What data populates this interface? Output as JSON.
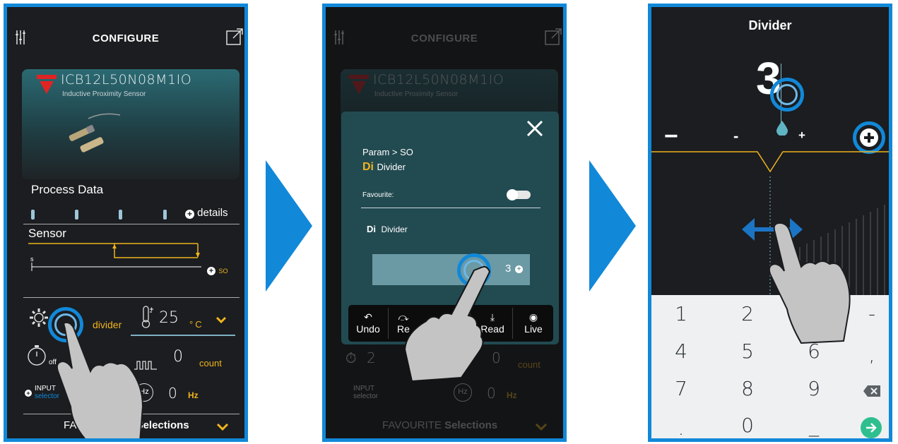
{
  "panel1": {
    "title": "CONFIGURE",
    "device_model": "ICB12L50N08M1IO",
    "device_type": "Inductive Proximity Sensor",
    "process_data_label": "Process Data",
    "details_label": "details",
    "sensor_label": "Sensor",
    "chart_s_label": "s",
    "so_label": "SO",
    "divider_label": "divider",
    "temperature_value": "25",
    "temperature_unit": "°C",
    "timer_off_label": "off",
    "count_value": "0",
    "count_unit": "count",
    "input_label": "INPUT",
    "input_sub": "selector",
    "hz_icon_label": "Hz",
    "hz_value": "0",
    "hz_unit": "Hz",
    "favourite_prefix": "FAVOURITE",
    "favourite_bold": "Selections",
    "visible_favourite_prefix": "FAVOUR"
  },
  "panel2": {
    "title": "CONFIGURE",
    "device_model": "ICB12L50N08M1IO",
    "device_type": "Inductive Proximity Sensor",
    "breadcrumb": "Param > SO",
    "param_code": "Di",
    "param_name": "Divider",
    "favourite_label": "Favourite:",
    "field_code": "Di",
    "field_name": "Divider",
    "field_value": "3",
    "toolbar": [
      "Undo",
      "Re",
      "Read",
      "Live"
    ],
    "bg_timer_value": "2",
    "bg_count_value": "0",
    "bg_count_unit": "count",
    "bg_input_label": "INPUT",
    "bg_input_sub": "selector",
    "bg_hz_icon": "Hz",
    "bg_hz_value": "0",
    "bg_hz_unit": "Hz",
    "favourite_prefix": "FAVOURITE",
    "favourite_bold": "Selections"
  },
  "panel3": {
    "title": "Divider",
    "value": "3",
    "minus_big": "−",
    "minus_small": "-",
    "plus_small": "+",
    "keypad": [
      "1",
      "2",
      "-",
      "4",
      "5",
      "6",
      ",",
      "7",
      "8",
      "9",
      "0",
      ".",
      "_"
    ]
  },
  "colors": {
    "accent_blue": "#1188d8",
    "yellow": "#f0b41e",
    "teal": "#2b6a73",
    "dark": "#1b1d20"
  }
}
